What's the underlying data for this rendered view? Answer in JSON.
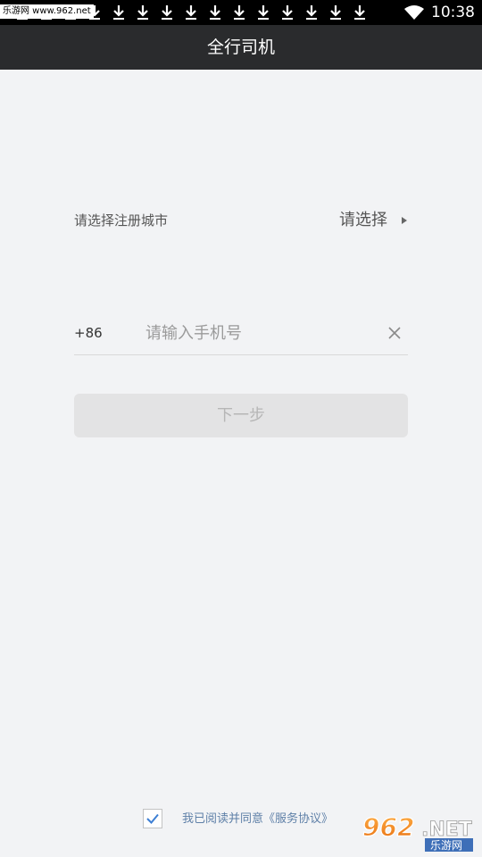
{
  "status_bar": {
    "watermark": "乐游网 www.962.net",
    "time": "10:38",
    "download_icon": "download-arrow-icon",
    "wifi_icon": "wifi-icon"
  },
  "header": {
    "title": "全行司机"
  },
  "city": {
    "label": "请选择注册城市",
    "value": "请选择",
    "icon": "triangle-right-icon"
  },
  "phone": {
    "country_code": "+86",
    "placeholder": "请输入手机号",
    "value": "",
    "clear_icon": "close-icon"
  },
  "next_button": {
    "label": "下一步"
  },
  "agreement": {
    "text": "我已阅读并同意《服务协议》",
    "checked": true,
    "check_color": "#3d7fd4"
  },
  "corner_logo": {
    "brand": "962.NET",
    "subtitle": "乐游网"
  },
  "colors": {
    "header_bg": "#2a2b2d",
    "page_bg": "#f2f3f5",
    "link_text": "#5f80a8",
    "logo_accent": "#f28a1e"
  }
}
